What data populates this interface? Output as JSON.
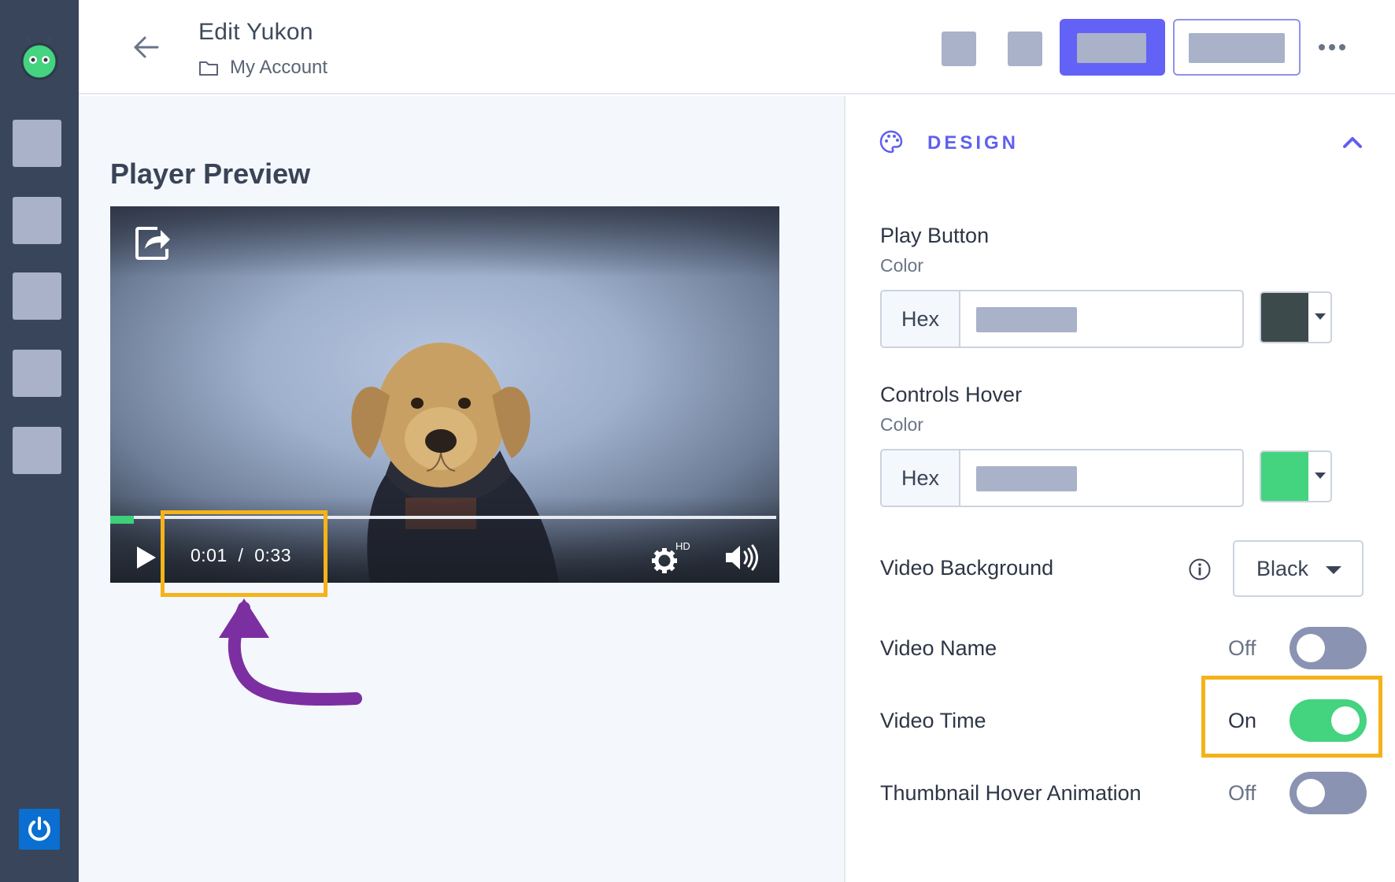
{
  "header": {
    "title": "Edit Yukon",
    "breadcrumb": "My Account"
  },
  "preview": {
    "heading": "Player Preview",
    "time_display": "0:01  /  0:33",
    "current_time": "0:01",
    "total_time": "0:33",
    "progress_percent": 3.5,
    "settings_badge": "HD"
  },
  "design": {
    "section_label": "DESIGN",
    "play_button": {
      "label": "Play Button",
      "sublabel": "Color",
      "prefix": "Hex",
      "swatch_color": "#3d4a4b"
    },
    "controls_hover": {
      "label": "Controls Hover",
      "sublabel": "Color",
      "prefix": "Hex",
      "swatch_color": "#44d37f"
    },
    "video_background": {
      "label": "Video Background",
      "value": "Black"
    },
    "video_name": {
      "label": "Video Name",
      "state": "Off",
      "on": false
    },
    "video_time": {
      "label": "Video Time",
      "state": "On",
      "on": true
    },
    "thumbnail_hover": {
      "label": "Thumbnail Hover Animation",
      "state": "Off",
      "on": false
    }
  },
  "colors": {
    "accent": "#6262f6",
    "toggle_on": "#44d37f",
    "toggle_off": "#8a93b2",
    "highlight": "#f4b31a",
    "annotation_arrow": "#7b2fa0"
  }
}
